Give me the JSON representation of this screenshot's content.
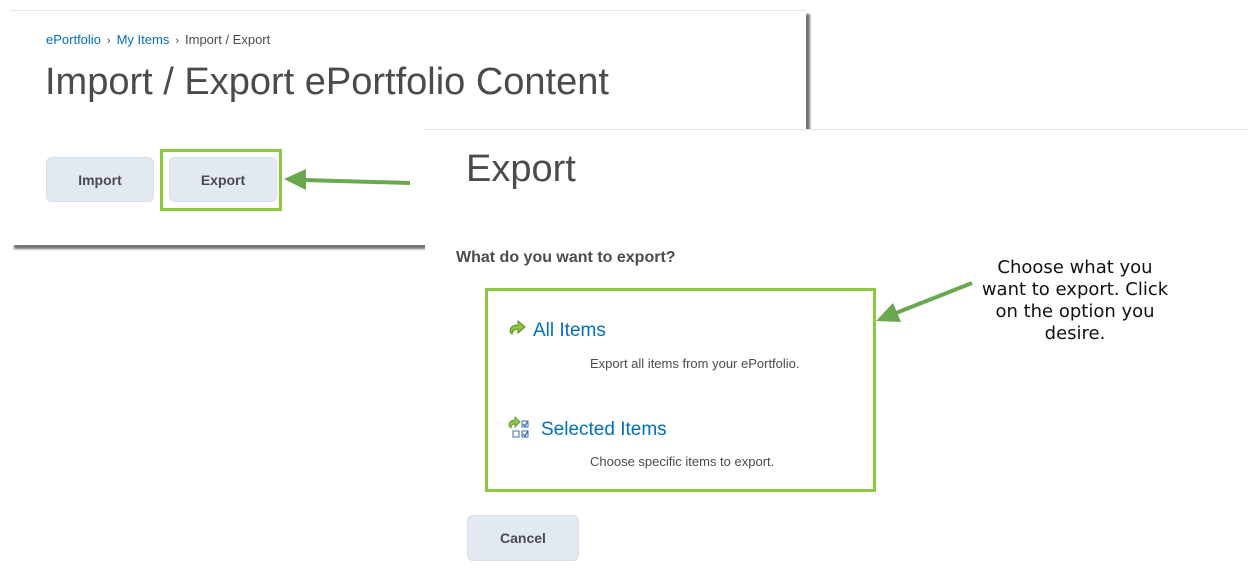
{
  "breadcrumb": {
    "items": [
      "ePortfolio",
      "My Items"
    ],
    "current": "Import / Export",
    "separator": "›"
  },
  "import_page": {
    "title": "Import / Export ePortfolio Content",
    "import_label": "Import",
    "export_label": "Export"
  },
  "export_page": {
    "title": "Export",
    "question": "What do you want to export?",
    "options": [
      {
        "label": "All Items",
        "description": "Export all items from your ePortfolio.",
        "icon": "export-all-icon"
      },
      {
        "label": "Selected Items",
        "description": "Choose specific items to export.",
        "icon": "export-selected-icon"
      }
    ],
    "cancel_label": "Cancel"
  },
  "annotation": {
    "text": "Choose what you want to export. Click on the option you desire."
  },
  "colors": {
    "highlight": "#8dc63f",
    "link": "#006fbf",
    "button_bg": "#e3e9f1",
    "text": "#494c4e"
  }
}
